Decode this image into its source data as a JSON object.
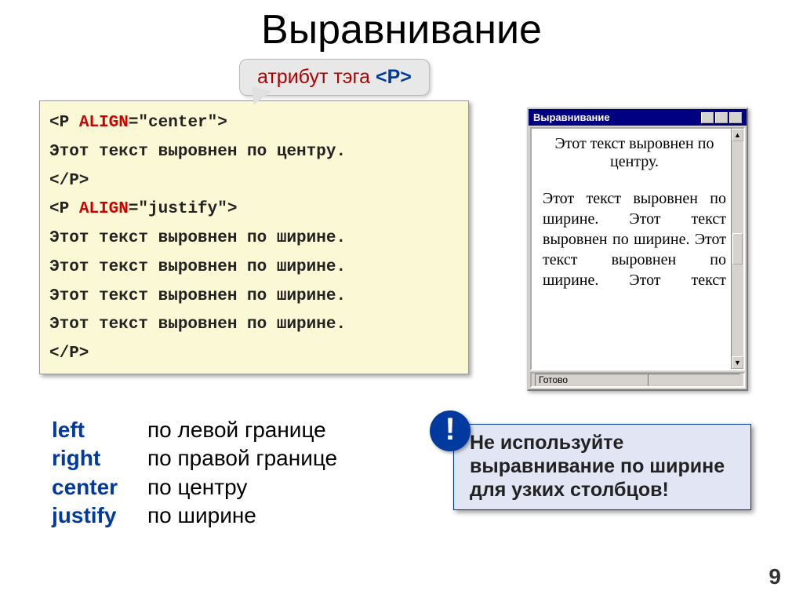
{
  "title": "Выравнивание",
  "callout": {
    "text": "атрибут тэга ",
    "tag": "<P>"
  },
  "code": {
    "l1_open": "<P ",
    "l1_attr": "ALIGN",
    "l1_eq": "=\"center\">",
    "l2": "Этот текст выровнен по центру.",
    "l3": "</P>",
    "l4_open": "<P ",
    "l4_attr": "ALIGN",
    "l4_eq": "=\"justify\">",
    "l5": "Этот текст выровнен по ширине.",
    "l6": "Этот текст выровнен по ширине.",
    "l7": "Этот текст выровнен по ширине.",
    "l8": "Этот текст выровнен по ширине.",
    "l9": "</P>"
  },
  "browser": {
    "title": "Выравнивание",
    "p_center": "Этот текст выровнен по центру.",
    "p_justify": "Этот текст выровнен по ширине. Этот текст выровнен по ширине. Этот текст выровнен по ширине. Этот текст",
    "status": "Готово"
  },
  "aligns": [
    {
      "key": "left",
      "desc": "по левой границе"
    },
    {
      "key": "right",
      "desc": "по правой границе"
    },
    {
      "key": "center",
      "desc": "по центру"
    },
    {
      "key": "justify",
      "desc": "по ширине"
    }
  ],
  "warning": {
    "bang": "!",
    "text": "Не используйте выравнивание по ширине для узких столбцов!"
  },
  "page_number": "9"
}
